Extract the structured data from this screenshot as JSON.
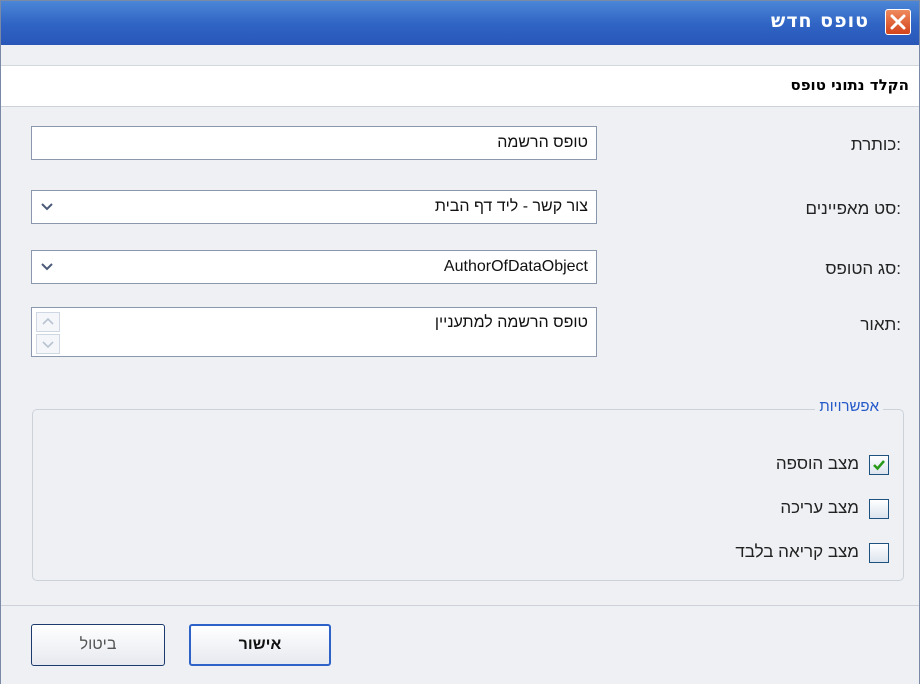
{
  "window": {
    "title": "טופס חדש",
    "close_icon": "close-icon"
  },
  "section": {
    "title": "הקלד נתוני טופס"
  },
  "fields": {
    "title_label": "כותרת:",
    "title_value": "טופס הרשמה",
    "property_set_label": "סט מאפיינים:",
    "property_set_value": "צור קשר - ליד דף הבית",
    "form_type_label": "סג הטופס:",
    "form_type_value": "AuthorOfDataObject",
    "description_label": "תאור:",
    "description_value": "טופס הרשמה למתעניין"
  },
  "options": {
    "legend": "אפשרויות",
    "items": [
      {
        "label": "מצב הוספה",
        "checked": true
      },
      {
        "label": "מצב עריכה",
        "checked": false
      },
      {
        "label": "מצב קריאה בלבד",
        "checked": false
      }
    ]
  },
  "buttons": {
    "ok": "אישור",
    "cancel": "ביטול"
  },
  "colors": {
    "titlebar": "#2f63c4",
    "legend": "#2459c9",
    "checkmark": "#2a9a1a",
    "close": "#d3431b"
  }
}
